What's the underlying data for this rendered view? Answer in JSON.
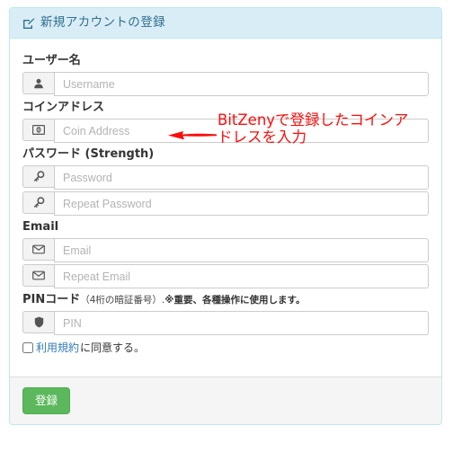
{
  "panel": {
    "heading": {
      "icon": "edit-square-icon",
      "title": "新規アカウントの登録"
    },
    "colors": {
      "header_bg": "#d9edf7",
      "header_border": "#bce8f1",
      "header_text": "#31708f",
      "button_green": "#5cb85c",
      "annotation_red": "#fb0d0d",
      "link_blue": "#337ab7"
    }
  },
  "fields": [
    {
      "label": "ユーザー名",
      "icon": "user-icon",
      "placeholder": "Username",
      "value": "",
      "type": "text"
    },
    {
      "label": "コインアドレス",
      "icon": "money-bill-icon",
      "placeholder": "Coin Address",
      "value": "",
      "type": "text"
    },
    {
      "label": "パスワード (Strength)",
      "icon": "key-icon",
      "placeholder": "Password",
      "value": "",
      "type": "password"
    },
    {
      "label": "",
      "icon": "key-icon",
      "placeholder": "Repeat Password",
      "value": "",
      "type": "password"
    },
    {
      "label": "Email",
      "icon": "envelope-icon",
      "placeholder": "Email",
      "value": "",
      "type": "email"
    },
    {
      "label": "",
      "icon": "envelope-icon",
      "placeholder": "Repeat Email",
      "value": "",
      "type": "email"
    },
    {
      "label": "PINコード",
      "icon": "shield-icon",
      "placeholder": "PIN",
      "value": "",
      "type": "text"
    }
  ],
  "labels": {
    "username": "ユーザー名",
    "coin_address": "コインアドレス",
    "password": "パスワード (Strength)",
    "email": "Email",
    "pin_main": "PINコード",
    "pin_note_a": "（4桁の暗証番号）.",
    "pin_note_b": "※重要、各種操作に使用します。"
  },
  "terms": {
    "checked": false,
    "link_text": "利用規約",
    "rest_text": "に同意する。"
  },
  "footer": {
    "submit_label": "登録"
  },
  "annotation": {
    "line1": "BitZenyで登録したコインア",
    "line2": "ドレスを入力",
    "arrow": "left-arrow-annotation"
  }
}
